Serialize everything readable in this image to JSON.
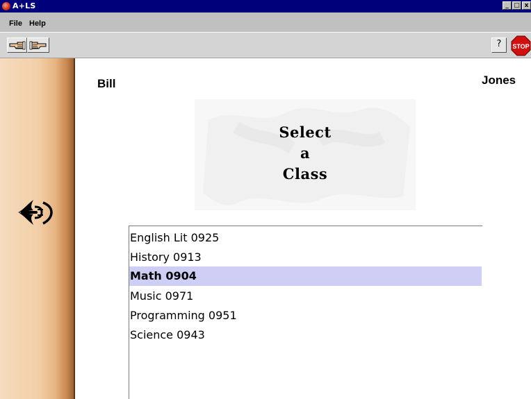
{
  "window": {
    "title": "A+LS",
    "controls": {
      "minimize": "_",
      "maximize": "□",
      "close": "x"
    }
  },
  "menu": {
    "file": "File",
    "help": "Help"
  },
  "toolbar": {
    "back_icon": "hand-pointing-left-icon",
    "forward_icon": "hand-pointing-right-icon",
    "help_glyph": "?",
    "stop_label": "STOP"
  },
  "user": {
    "first_name": "Bill",
    "last_name": "Jones"
  },
  "heading": {
    "line1": "Select",
    "line2": "a",
    "line3": "Class"
  },
  "classes": {
    "items": [
      {
        "label": "English Lit 0925"
      },
      {
        "label": "History 0913"
      },
      {
        "label": "Math 0904"
      },
      {
        "label": "Music 0971"
      },
      {
        "label": "Programming 0951"
      },
      {
        "label": "Science 0943"
      }
    ],
    "selected": "Math 0904"
  },
  "colors": {
    "titlebar": "#00007b",
    "selection": "#cfcff5",
    "stop_red": "#d01010"
  }
}
